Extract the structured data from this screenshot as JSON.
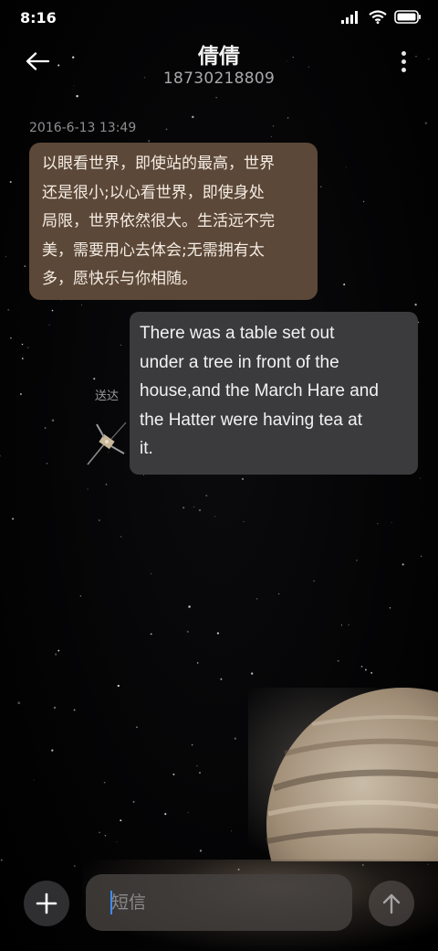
{
  "status_bar": {
    "time": "8:16",
    "icons": [
      "signal-icon",
      "wifi-icon",
      "battery-icon"
    ]
  },
  "header": {
    "contact_name": "倩倩",
    "contact_number": "18730218809",
    "back_icon": "arrow-left-icon",
    "more_icon": "more-vertical-icon"
  },
  "conversation": {
    "messages": [
      {
        "direction": "incoming",
        "timestamp": "2016-6-13 13:49",
        "lines": [
          "以眼看世界，即使站的最高，世界",
          "还是很小;以心看世界，即使身处",
          "局限，世界依然很大。生活远不完",
          "美，需要用心去体会;无需拥有太",
          "多，愿快乐与你相随。"
        ]
      },
      {
        "direction": "outgoing",
        "status": "送达",
        "lines": [
          "There was a table set out",
          "under a tree in front of the",
          "house,and the March Hare and",
          "the Hatter were having tea at",
          "it."
        ]
      }
    ]
  },
  "composer": {
    "placeholder": "短信",
    "value": "",
    "add_icon": "plus-icon",
    "send_icon": "arrow-up-icon"
  },
  "theme": {
    "incoming_bubble": "#5c4838",
    "outgoing_bubble": "#3b3b3d",
    "caret": "#3f8cff"
  }
}
